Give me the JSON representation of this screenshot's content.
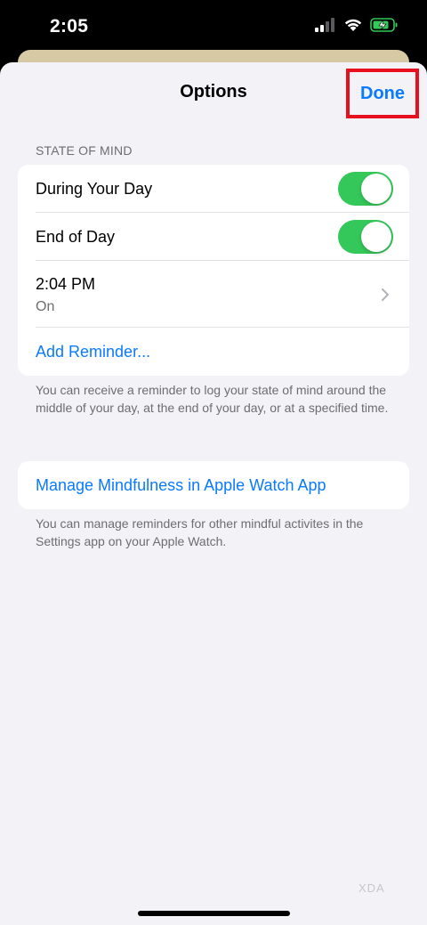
{
  "status_bar": {
    "time": "2:05"
  },
  "nav": {
    "title": "Options",
    "done_label": "Done"
  },
  "state_of_mind": {
    "header": "STATE OF MIND",
    "during_day": {
      "label": "During Your Day",
      "on": true
    },
    "end_of_day": {
      "label": "End of Day",
      "on": true
    },
    "reminder": {
      "time": "2:04 PM",
      "status": "On"
    },
    "add_reminder_label": "Add Reminder...",
    "footnote": "You can receive a reminder to log your state of mind around the middle of your day, at the end of your day, or at a specified time."
  },
  "watch": {
    "manage_label": "Manage Mindfulness in Apple Watch App",
    "footnote": "You can manage reminders for other mindful activites in the Settings app on your Apple Watch."
  },
  "watermark": "XDA",
  "colors": {
    "accent": "#0a7aff",
    "toggle_on": "#34c759",
    "highlight_box": "#e8101e"
  },
  "icons": [
    "cellular-signal-icon",
    "wifi-icon",
    "battery-charging-icon",
    "chevron-right-icon"
  ]
}
